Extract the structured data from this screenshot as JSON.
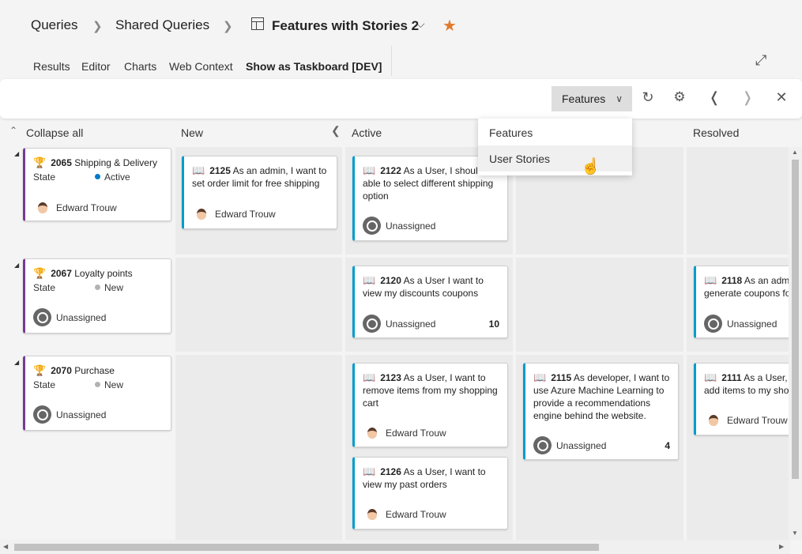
{
  "breadcrumb": {
    "items": [
      "Queries",
      "Shared Queries",
      "Features with Stories 2"
    ],
    "separator": ">"
  },
  "tabs": [
    "Results",
    "Editor",
    "Charts",
    "Web Context",
    "Show as Taskboard [DEV]"
  ],
  "toolbar": {
    "selected_view": "Features"
  },
  "dropdown": {
    "options": [
      "Features",
      "User Stories"
    ],
    "hovered": "User Stories"
  },
  "board": {
    "collapse_label": "Collapse all",
    "columns": [
      "New",
      "Active",
      "Resolved"
    ]
  },
  "features": [
    {
      "id": "2065",
      "title": "Shipping & Delivery",
      "state_label": "State",
      "state": "Active",
      "state_color": "#007acc",
      "assignee": "Edward Trouw"
    },
    {
      "id": "2067",
      "title": "Loyalty points",
      "state_label": "State",
      "state": "New",
      "state_color": "#b2b2b2",
      "assignee": "Unassigned"
    },
    {
      "id": "2070",
      "title": "Purchase",
      "state_label": "State",
      "state": "New",
      "state_color": "#b2b2b2",
      "assignee": "Unassigned"
    }
  ],
  "stories": {
    "s2125": {
      "id": "2125",
      "text": "As an admin, I want to set order limit for free shipping",
      "assignee": "Edward Trouw"
    },
    "s2122": {
      "id": "2122",
      "text": "As a User, I should be able to select different shipping option",
      "assignee": "Unassigned"
    },
    "s2120": {
      "id": "2120",
      "text": "As a User I want to view my discounts coupons",
      "assignee": "Unassigned",
      "effort": "10"
    },
    "s2118": {
      "id": "2118",
      "text": "As an admin I want to generate coupons for users",
      "assignee": "Unassigned"
    },
    "s2123": {
      "id": "2123",
      "text": "As a User, I want to remove items from my shopping cart",
      "assignee": "Edward Trouw"
    },
    "s2115": {
      "id": "2115",
      "text": "As developer, I want to use Azure Machine Learning to provide a recommendations engine behind the website.",
      "assignee": "Unassigned",
      "effort": "4"
    },
    "s2111": {
      "id": "2111",
      "text": "As a User, I want to add items to my shopping cart",
      "assignee": "Edward Trouw"
    },
    "s2126": {
      "id": "2126",
      "text": "As a User, I want to view my past orders",
      "assignee": "Edward Trouw"
    }
  },
  "colors": {
    "feature_accent": "#773b93",
    "story_accent": "#009ccc",
    "favorite_star": "#e07a2c"
  }
}
